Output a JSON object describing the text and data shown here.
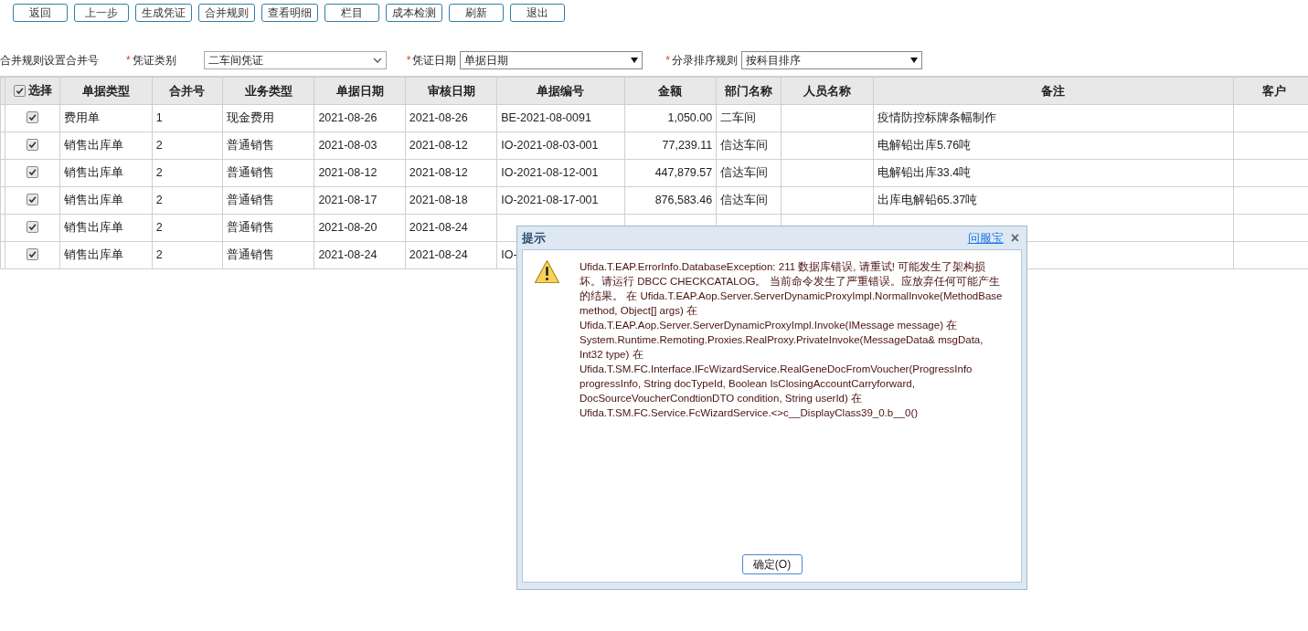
{
  "toolbar": [
    "返回",
    "上一步",
    "生成凭证",
    "合并规则",
    "查看明细",
    "栏目",
    "成本检测",
    "刷新",
    "退出"
  ],
  "filters": {
    "hint": "合并规则设置合并号",
    "fields": [
      {
        "required_mark": "*",
        "label": "凭证类别",
        "value": "二车间凭证",
        "kind": "chevron"
      },
      {
        "required_mark": "*",
        "label": "凭证日期",
        "value": "单据日期",
        "kind": "triangle"
      },
      {
        "required_mark": "*",
        "label": "分录排序规则",
        "value": "按科目排序",
        "kind": "triangle"
      }
    ]
  },
  "table": {
    "select_all": {
      "label": "选择",
      "checked": true
    },
    "columns": [
      "单据类型",
      "合并号",
      "业务类型",
      "单据日期",
      "审核日期",
      "单据编号",
      "金额",
      "部门名称",
      "人员名称",
      "备注",
      "客户"
    ],
    "rows": [
      {
        "checked": true,
        "cells": {
          "0": "费用单",
          "1": "1",
          "2": "现金费用",
          "3": "2021-08-26",
          "4": "2021-08-26",
          "5": "BE-2021-08-0091",
          "6": "1,050.00",
          "7": "二车间",
          "9": "疫情防控标牌条幅制作"
        }
      },
      {
        "checked": true,
        "cells": {
          "0": "销售出库单",
          "1": "2",
          "2": "普通销售",
          "3": "2021-08-03",
          "4": "2021-08-12",
          "5": "IO-2021-08-03-001",
          "6": "77,239.11",
          "7": "信达车间",
          "9": "电解铅出库5.76吨"
        }
      },
      {
        "checked": true,
        "cells": {
          "0": "销售出库单",
          "1": "2",
          "2": "普通销售",
          "3": "2021-08-12",
          "4": "2021-08-12",
          "5": "IO-2021-08-12-001",
          "6": "447,879.57",
          "7": "信达车间",
          "9": "电解铅出库33.4吨"
        }
      },
      {
        "checked": true,
        "cells": {
          "0": "销售出库单",
          "1": "2",
          "2": "普通销售",
          "3": "2021-08-17",
          "4": "2021-08-18",
          "5": "IO-2021-08-17-001",
          "6": "876,583.46",
          "7": "信达车间",
          "9": "出库电解铅65.37吨"
        }
      },
      {
        "checked": true,
        "cells": {
          "0": "销售出库单",
          "1": "2",
          "2": "普通销售",
          "3": "2021-08-20",
          "4": "2021-08-24"
        }
      },
      {
        "checked": true,
        "cells": {
          "0": "销售出库单",
          "1": "2",
          "2": "普通销售",
          "3": "2021-08-24",
          "4": "2021-08-24",
          "5": "IO-"
        }
      }
    ]
  },
  "dialog": {
    "title": "提示",
    "help_link": "问服宝",
    "close": "×",
    "message": "Ufida.T.EAP.ErrorInfo.DatabaseException: 211 数据库错误, 请重试! 可能发生了架构损坏。请运行 DBCC CHECKCATALOG。 当前命令发生了严重错误。应放弃任何可能产生的结果。 在 Ufida.T.EAP.Aop.Server.ServerDynamicProxyImpl.NormalInvoke(MethodBase method, Object[] args) 在 Ufida.T.EAP.Aop.Server.ServerDynamicProxyImpl.Invoke(IMessage message) 在 System.Runtime.Remoting.Proxies.RealProxy.PrivateInvoke(MessageData& msgData, Int32 type) 在 Ufida.T.SM.FC.Interface.IFcWizardService.RealGeneDocFromVoucher(ProgressInfo progressInfo, String docTypeId, Boolean IsClosingAccountCarryforward, DocSourceVoucherCondtionDTO condition, String userId) 在 Ufida.T.SM.FC.Service.FcWizardService.<>c__DisplayClass39_0.b__0()",
    "ok_button": "确定(O)"
  }
}
